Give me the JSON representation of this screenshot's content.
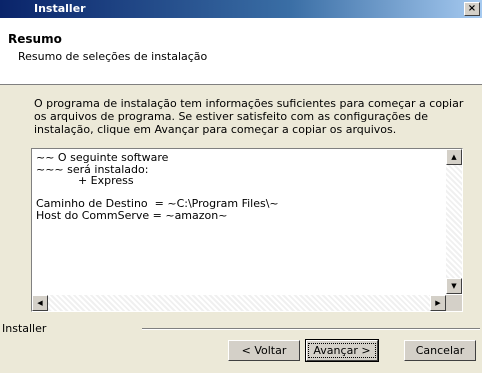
{
  "window": {
    "title": "Installer",
    "close_label": "×"
  },
  "header": {
    "title": "Resumo",
    "subtitle": "Resumo de seleções de instalação"
  },
  "description": "O programa de instalação tem informações suficientes para começar a copiar os arquivos de programa. Se estiver satisfeito com as configurações de instalação, clique em Avançar para começar a copiar os arquivos.",
  "summary_text": "~~ O seguinte software\n~~~ será instalado:\n            + Express\n\nCaminho de Destino  = ~C:\\Program Files\\~\nHost do CommServe = ~amazon~",
  "footer": {
    "label": "Installer"
  },
  "buttons": {
    "back": "< Voltar",
    "next": "Avançar >",
    "cancel": "Cancelar"
  },
  "icons": {
    "scroll_up": "up-arrow-icon",
    "scroll_down": "down-arrow-icon",
    "scroll_left": "left-arrow-icon",
    "scroll_right": "right-arrow-icon"
  }
}
